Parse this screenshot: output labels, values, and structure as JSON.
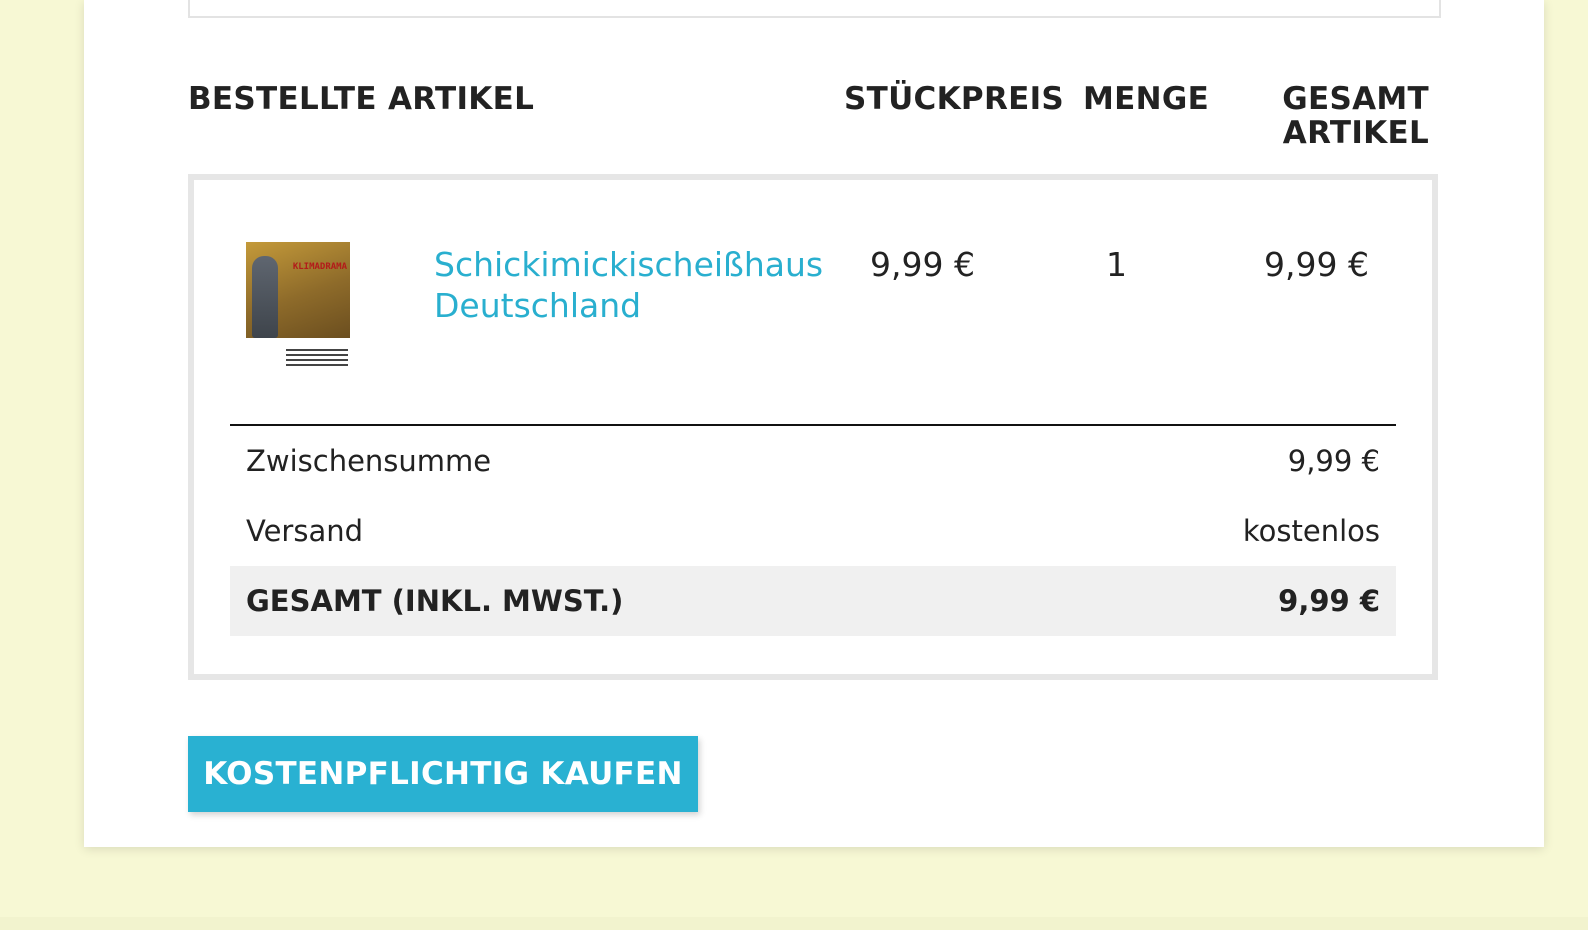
{
  "table": {
    "headers": {
      "artikel": "BESTELLTE ARTIKEL",
      "stueckpreis": "STÜCKPREIS",
      "menge": "MENGE",
      "gesamt_line1": "GESAMT",
      "gesamt_line2": "ARTIKEL"
    },
    "items": [
      {
        "name_line1": "Schickimickischeißhaus",
        "name_line2": "Deutschland",
        "thumbnail_title": "KLIMADRAMA",
        "unit_price": "9,99 €",
        "quantity": "1",
        "total": "9,99 €"
      }
    ]
  },
  "summary": {
    "subtotal_label": "Zwischensumme",
    "subtotal_value": "9,99 €",
    "shipping_label": "Versand",
    "shipping_value": "kostenlos",
    "total_label": "GESAMT (INKL. MWST.)",
    "total_value": "9,99 €"
  },
  "actions": {
    "buy_label": "KOSTENPFLICHTIG KAUFEN"
  },
  "colors": {
    "background": "#f7f8d4",
    "accent": "#29b1d2",
    "link": "#29afcf"
  }
}
